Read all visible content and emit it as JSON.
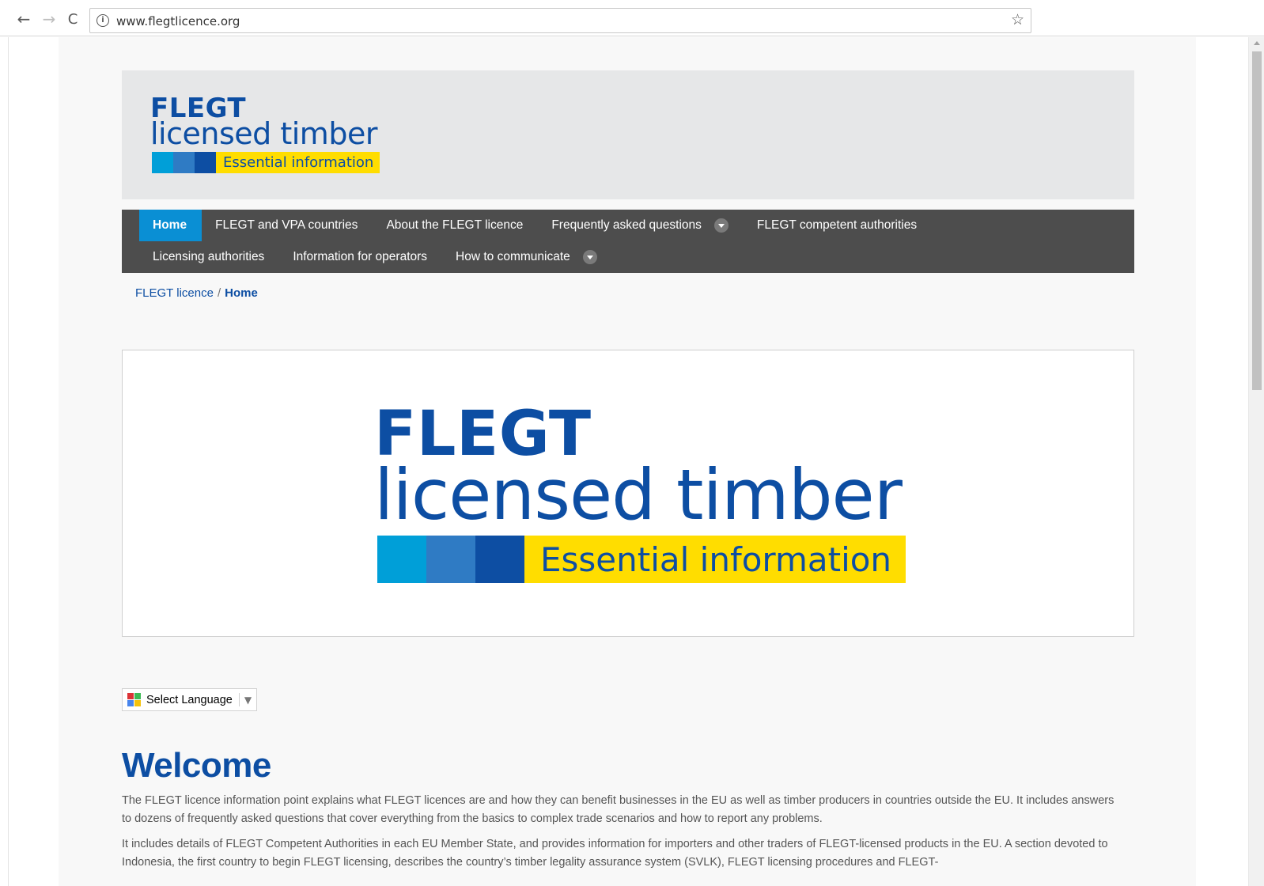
{
  "browser": {
    "back_icon": "←",
    "forward_icon": "→",
    "reload_icon": "C",
    "url": "www.flegtlicence.org",
    "info_icon": "i",
    "star_icon": "☆"
  },
  "logo": {
    "line1": "FLEGT",
    "line2": "licensed timber",
    "tagline": "Essential information",
    "colors": {
      "navy": "#0d4ea3",
      "cyan": "#009fd8",
      "mid_blue": "#2f7bc4",
      "yellow": "#ffdd00"
    }
  },
  "menu": {
    "row1": [
      {
        "label": "Home",
        "active": true
      },
      {
        "label": "FLEGT and VPA countries"
      },
      {
        "label": "About the FLEGT licence"
      },
      {
        "label": "Frequently asked questions",
        "has_dropdown": true
      },
      {
        "label": "FLEGT competent authorities"
      }
    ],
    "row2": [
      {
        "label": "Licensing authorities"
      },
      {
        "label": "Information for operators"
      },
      {
        "label": "How to communicate",
        "has_dropdown": true
      }
    ],
    "colors": {
      "bar": "#4d4d4d",
      "active": "#0a8fd4"
    }
  },
  "breadcrumb": {
    "parent": "FLEGT licence",
    "separator": "/",
    "current": "Home"
  },
  "hero": {
    "line1": "FLEGT",
    "line2": "licensed timber",
    "tagline": "Essential information"
  },
  "language": {
    "label": "Select Language",
    "arrow": "▼"
  },
  "welcome": {
    "title": "Welcome",
    "paragraph1": "The FLEGT licence information point explains what FLEGT licences are and how they can benefit businesses in the EU as well as timber producers in countries outside the EU. It includes answers to dozens of frequently asked questions that cover everything from the basics to complex trade scenarios and how to report any problems.",
    "paragraph2": "It includes details of FLEGT Competent Authorities in each EU Member State, and provides information for importers and other traders of FLEGT-licensed products in the EU. A section devoted to Indonesia, the first country to begin FLEGT licensing, describes the country’s timber legality assurance system (SVLK), FLEGT licensing procedures and FLEGT-"
  }
}
